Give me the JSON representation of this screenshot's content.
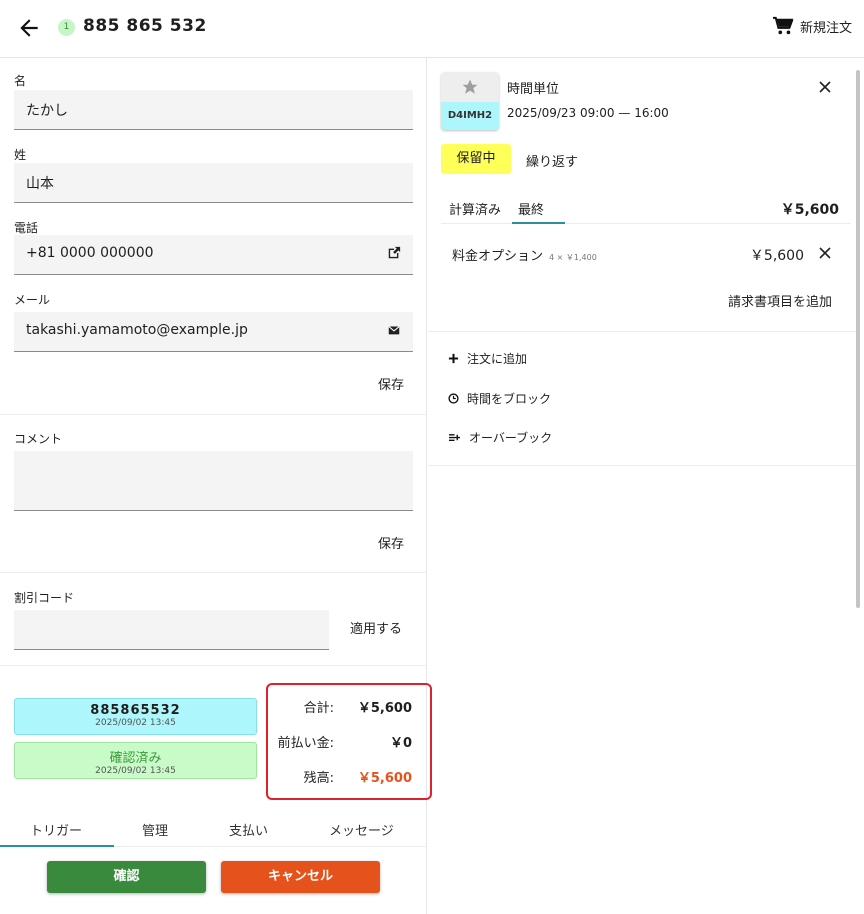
{
  "header": {
    "badge": "1",
    "title": "885 865 532",
    "new_order_label": "新規注文"
  },
  "form": {
    "first_name_label": "名",
    "first_name_value": "たかし",
    "last_name_label": "姓",
    "last_name_value": "山本",
    "phone_label": "電話",
    "phone_value": "+81 0000 000000",
    "email_label": "メール",
    "email_value": "takashi.yamamoto@example.jp",
    "save_label": "保存",
    "comment_label": "コメント",
    "comment_save_label": "保存",
    "discount_label": "割引コード",
    "apply_label": "適用する"
  },
  "order_status": {
    "id_value": "885865532",
    "id_timestamp": "2025/09/02 13:45",
    "confirmed_label": "確認済み",
    "confirmed_timestamp": "2025/09/02 13:45"
  },
  "totals": {
    "total_label": "合計:",
    "total_value": "￥5,600",
    "prepaid_label": "前払い金:",
    "prepaid_value": "￥0",
    "balance_label": "残高:",
    "balance_value": "￥5,600",
    "balance_color": "#e5521c",
    "highlight_color": "#e0212a"
  },
  "bottom_tabs": [
    "トリガー",
    "管理",
    "支払い",
    "メッセージ"
  ],
  "buttons": {
    "confirm_label": "確認",
    "cancel_label": "キャンセル"
  },
  "booking": {
    "thumb_code": "D4IMH2",
    "service_name": "時間単位",
    "time_range": "2025/09/23 09:00 — 16:00",
    "hold_label": "保留中",
    "repeat_label": "繰り返す",
    "tabs": [
      "計算済み",
      "最終"
    ],
    "total": "￥5,600",
    "line_item_label": "料金オプション",
    "line_item_detail": "4 × ￥1,400",
    "line_item_price": "￥5,600",
    "add_invoice_label": "請求書項目を追加"
  },
  "actions": {
    "add_to_order": "注文に追加",
    "block_time": "時間をブロック",
    "overbook": "オーバーブック"
  }
}
